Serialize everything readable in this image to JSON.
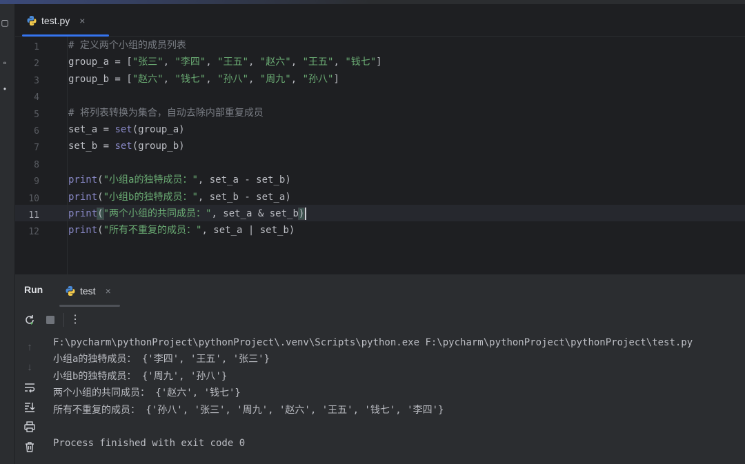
{
  "editor_tab": {
    "filename": "test.py",
    "close_glyph": "×"
  },
  "editor": {
    "line_numbers": [
      "1",
      "2",
      "3",
      "4",
      "5",
      "6",
      "7",
      "8",
      "9",
      "10",
      "11",
      "12"
    ],
    "active_line": "11",
    "lines": [
      {
        "segs": [
          {
            "t": "# 定义两个小组的成员列表",
            "c": "cmt"
          }
        ]
      },
      {
        "segs": [
          {
            "t": "group_a = ["
          },
          {
            "t": "\"张三\"",
            "c": "str"
          },
          {
            "t": ", "
          },
          {
            "t": "\"李四\"",
            "c": "str"
          },
          {
            "t": ", "
          },
          {
            "t": "\"王五\"",
            "c": "str"
          },
          {
            "t": ", "
          },
          {
            "t": "\"赵六\"",
            "c": "str"
          },
          {
            "t": ", "
          },
          {
            "t": "\"王五\"",
            "c": "str"
          },
          {
            "t": ", "
          },
          {
            "t": "\"钱七\"",
            "c": "str"
          },
          {
            "t": "]"
          }
        ]
      },
      {
        "segs": [
          {
            "t": "group_b = ["
          },
          {
            "t": "\"赵六\"",
            "c": "str"
          },
          {
            "t": ", "
          },
          {
            "t": "\"钱七\"",
            "c": "str"
          },
          {
            "t": ", "
          },
          {
            "t": "\"孙八\"",
            "c": "str"
          },
          {
            "t": ", "
          },
          {
            "t": "\"周九\"",
            "c": "str"
          },
          {
            "t": ", "
          },
          {
            "t": "\"孙八\"",
            "c": "str"
          },
          {
            "t": "]"
          }
        ]
      },
      {
        "segs": []
      },
      {
        "segs": [
          {
            "t": "# 将列表转换为集合，自动去除内部重复成员",
            "c": "cmt"
          }
        ]
      },
      {
        "segs": [
          {
            "t": "set_a = "
          },
          {
            "t": "set",
            "c": "bi"
          },
          {
            "t": "(group_a)"
          }
        ]
      },
      {
        "segs": [
          {
            "t": "set_b = "
          },
          {
            "t": "set",
            "c": "bi"
          },
          {
            "t": "(group_b)"
          }
        ]
      },
      {
        "segs": []
      },
      {
        "segs": [
          {
            "t": "print",
            "c": "bi"
          },
          {
            "t": "("
          },
          {
            "t": "\"小组a的独特成员：\"",
            "c": "str"
          },
          {
            "t": ", set_a - set_b)"
          }
        ]
      },
      {
        "segs": [
          {
            "t": "print",
            "c": "bi"
          },
          {
            "t": "("
          },
          {
            "t": "\"小组b的独特成员：\"",
            "c": "str"
          },
          {
            "t": ", set_b - set_a)"
          }
        ]
      },
      {
        "segs": [
          {
            "t": "print",
            "c": "bi"
          },
          {
            "t": "(",
            "c": "bracket-hl"
          },
          {
            "t": "\"两个小组的共同成员：\"",
            "c": "str"
          },
          {
            "t": ", set_a & set_b"
          },
          {
            "t": ")",
            "c": "bracket-hl"
          },
          {
            "caret": true
          }
        ]
      },
      {
        "segs": [
          {
            "t": "print",
            "c": "bi"
          },
          {
            "t": "("
          },
          {
            "t": "\"所有不重复的成员：\"",
            "c": "str"
          },
          {
            "t": ", set_a | set_b)"
          }
        ]
      }
    ]
  },
  "run_panel": {
    "title": "Run",
    "tab_label": "test",
    "close_glyph": "×",
    "toolbar_icons": [
      "rerun-icon",
      "stop-icon",
      "more-icon"
    ],
    "side_icons": [
      "up-arrow-icon",
      "down-arrow-icon",
      "soft-wrap-icon",
      "scroll-to-end-icon",
      "print-icon",
      "trash-icon"
    ],
    "output": [
      "F:\\pycharm\\pythonProject\\pythonProject\\.venv\\Scripts\\python.exe F:\\pycharm\\pythonProject\\pythonProject\\test.py",
      "小组a的独特成员： {'李四', '王五', '张三'}",
      "小组b的独特成员： {'周九', '孙八'}",
      "两个小组的共同成员： {'赵六', '钱七'}",
      "所有不重复的成员： {'孙八', '张三', '周九', '赵六', '王五', '钱七', '李四'}",
      "",
      "Process finished with exit code 0"
    ]
  },
  "colors": {
    "editor_bg": "#1e1f22",
    "panel_bg": "#2b2d30",
    "accent": "#3574f0",
    "string": "#6aab73",
    "comment": "#7a7e85",
    "builtin": "#8888c6"
  }
}
